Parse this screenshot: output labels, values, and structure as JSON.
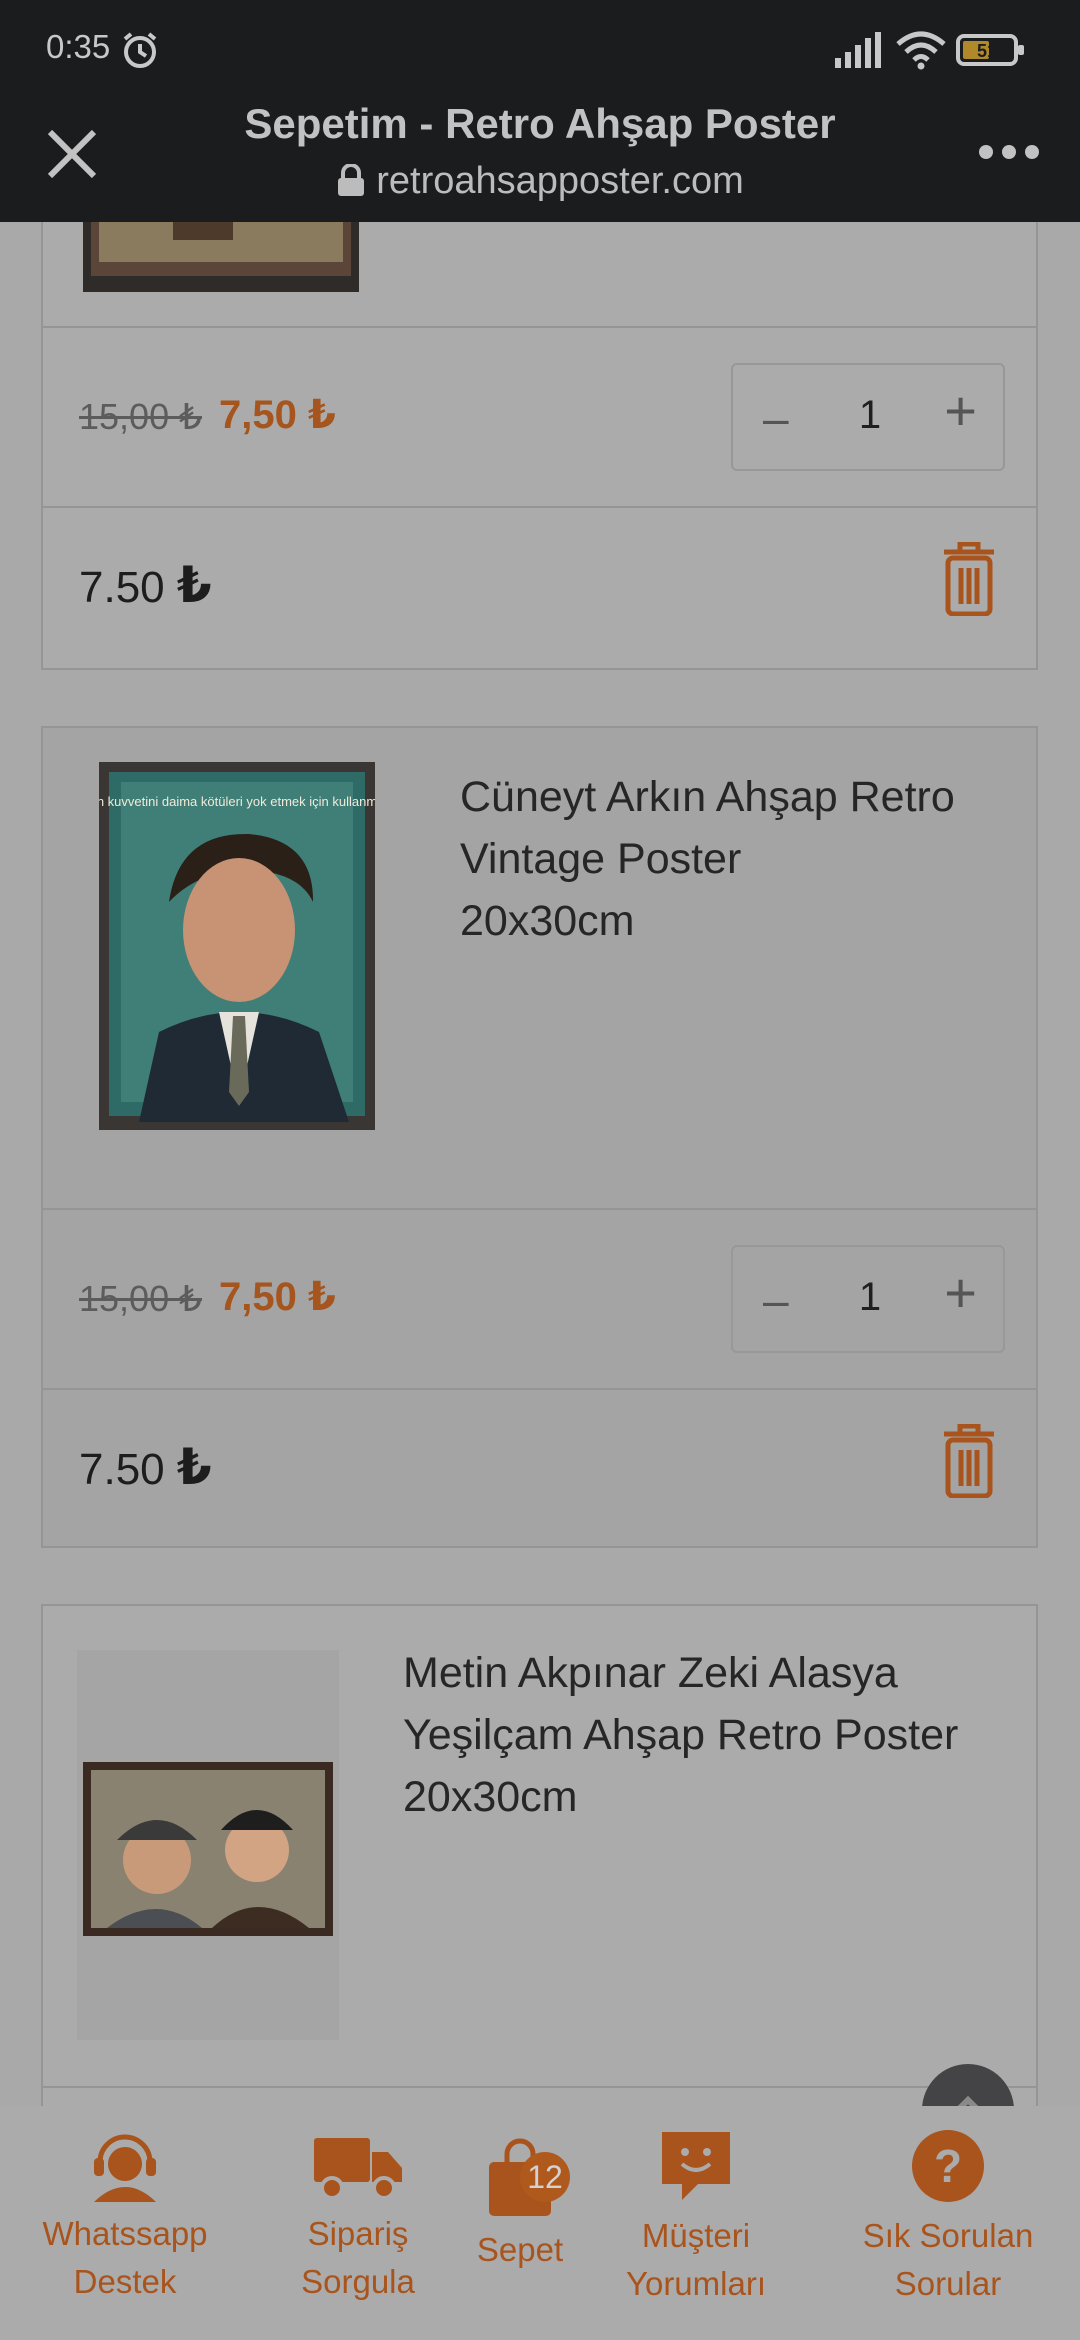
{
  "status_bar": {
    "time": "0:35",
    "battery": "51"
  },
  "browser": {
    "title": "Sepetim - Retro Ahşap Poster",
    "url": "retroahsapposter.com"
  },
  "cart_items": [
    {
      "name": "",
      "old_price": "15,00 ₺",
      "new_price": "7,50 ₺",
      "quantity": "1",
      "total": "7.50",
      "currency": "₺"
    },
    {
      "name": "Cüneyt Arkın Ahşap Retro\nVintage Poster\n20x30cm",
      "image_caption": "İnsan kuvvetini daima kötüleri yok etmek için kullanmalı...",
      "old_price": "15,00 ₺",
      "new_price": "7,50 ₺",
      "quantity": "1",
      "total": "7.50",
      "currency": "₺"
    },
    {
      "name": "Metin Akpınar Zeki Alasya\nYeşilçam Ahşap Retro Poster\n20x30cm"
    }
  ],
  "qty_controls": {
    "minus": "–",
    "plus": "+"
  },
  "bottom_nav": [
    {
      "label": "Whatssapp\nDestek",
      "icon": "support-agent-icon"
    },
    {
      "label": "Sipariş\nSorgula",
      "icon": "truck-icon"
    },
    {
      "label": "Sepet",
      "icon": "shopping-bag-icon",
      "badge": "12"
    },
    {
      "label": "Müşteri\nYorumları",
      "icon": "chat-smile-icon"
    },
    {
      "label": "Sık Sorulan\nSorular",
      "icon": "question-icon"
    }
  ],
  "colors": {
    "accent": "#a8541c",
    "header_bg": "#1b1c1e",
    "overlay_bg": "#a9a9a9"
  }
}
